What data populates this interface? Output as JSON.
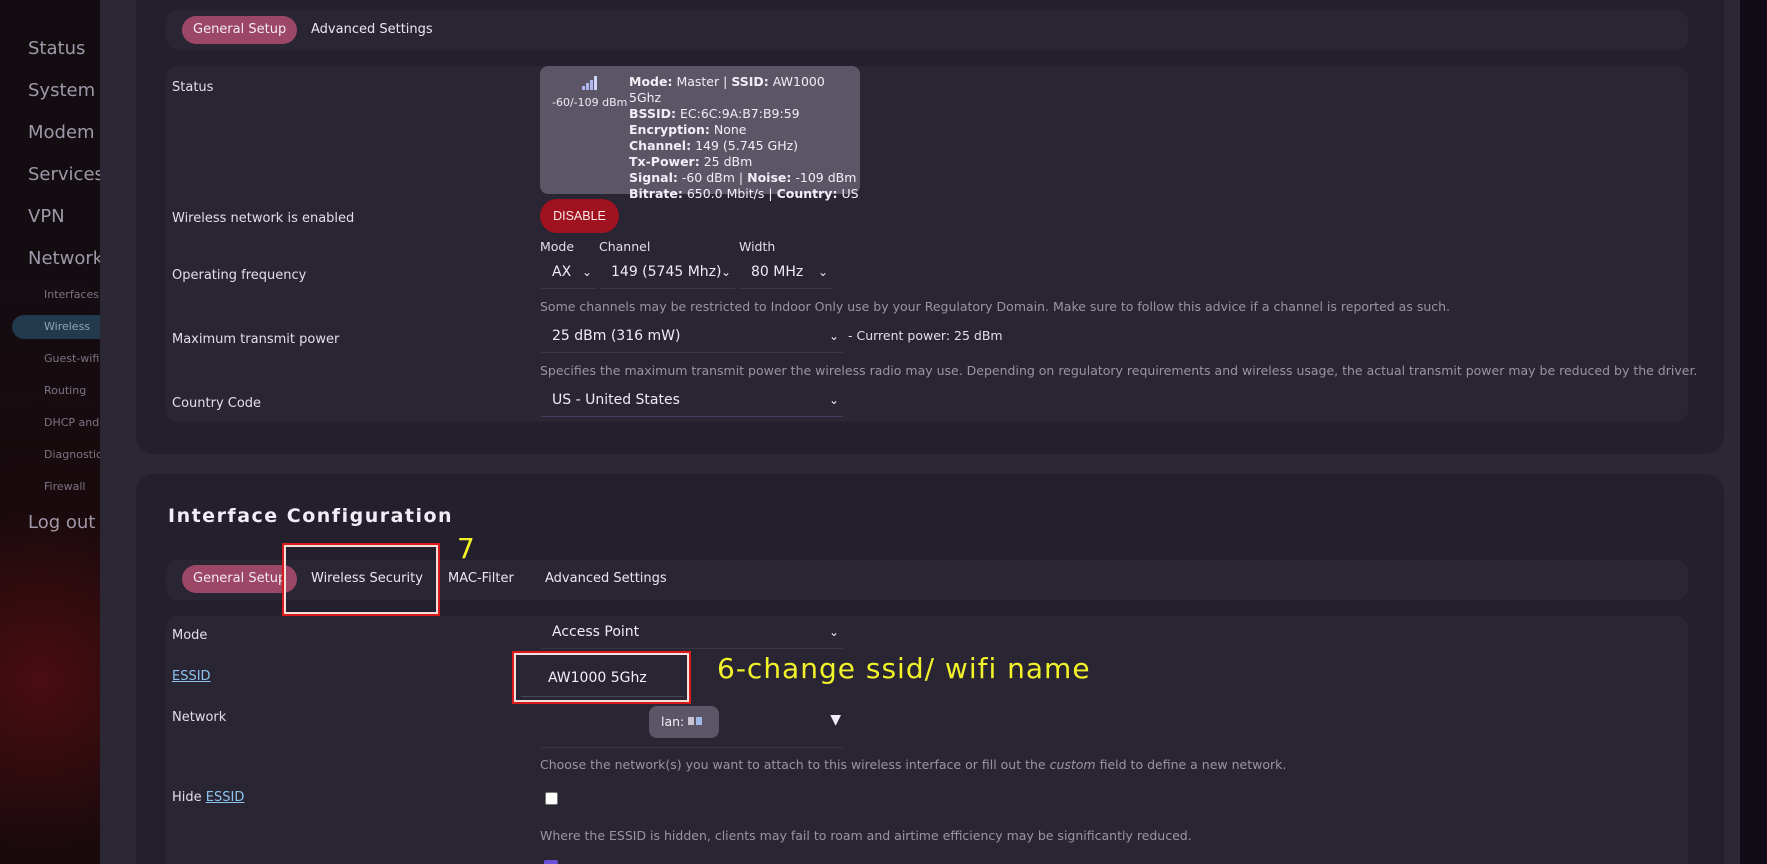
{
  "sidebar": {
    "items": [
      {
        "label": "Status"
      },
      {
        "label": "System"
      },
      {
        "label": "Modem"
      },
      {
        "label": "Services"
      },
      {
        "label": "VPN"
      },
      {
        "label": "Network"
      }
    ],
    "sub_items": [
      {
        "label": "Interfaces"
      },
      {
        "label": "Wireless"
      },
      {
        "label": "Guest-wifi"
      },
      {
        "label": "Routing"
      },
      {
        "label": "DHCP and"
      },
      {
        "label": "Diagnostic"
      },
      {
        "label": "Firewall"
      }
    ],
    "logout": "Log out"
  },
  "device_config": {
    "tabs": [
      {
        "label": "General Setup",
        "active": true
      },
      {
        "label": "Advanced Settings",
        "active": false
      }
    ],
    "status_label": "Status",
    "status": {
      "signal_text": "-60/-109 dBm",
      "mode_key": "Mode:",
      "mode_val": "Master",
      "ssid_key": "SSID:",
      "ssid_val": "AW1000 5Ghz",
      "bssid_key": "BSSID:",
      "bssid_val": "EC:6C:9A:B7:B9:59",
      "enc_key": "Encryption:",
      "enc_val": "None",
      "channel_key": "Channel:",
      "channel_val": "149 (5.745 GHz)",
      "txpower_key": "Tx-Power:",
      "txpower_val": "25 dBm",
      "signal_key": "Signal:",
      "signal_val": "-60 dBm",
      "noise_key": "Noise:",
      "noise_val": "-109 dBm",
      "bitrate_key": "Bitrate:",
      "bitrate_val": "650.0 Mbit/s",
      "country_key": "Country:",
      "country_val": "US",
      "separator": "|"
    },
    "wireless_enabled_label": "Wireless network is enabled",
    "disable_button": "DISABLE",
    "mode_head": "Mode",
    "channel_head": "Channel",
    "width_head": "Width",
    "operating_frequency_label": "Operating frequency",
    "mode_value": "AX",
    "channel_value": "149 (5745 Mhz)",
    "width_value": "80 MHz",
    "channel_hint": "Some channels may be restricted to Indoor Only use by your Regulatory Domain. Make sure to follow this advice if a channel is reported as such.",
    "max_tx_power_label": "Maximum transmit power",
    "tx_power_value": "25 dBm (316 mW)",
    "current_power_text": "- Current power: 25 dBm",
    "tx_power_hint": "Specifies the maximum transmit power the wireless radio may use. Depending on regulatory requirements and wireless usage, the actual transmit power may be reduced by the driver.",
    "country_code_label": "Country Code",
    "country_code_value": "US - United States"
  },
  "interface_config": {
    "title": "Interface Configuration",
    "tabs": [
      {
        "label": "General Setup",
        "active": true
      },
      {
        "label": "Wireless Security",
        "active": false
      },
      {
        "label": "MAC-Filter",
        "active": false
      },
      {
        "label": "Advanced Settings",
        "active": false
      }
    ],
    "mode_label": "Mode",
    "mode_value": "Access Point",
    "essid_label": "ESSID",
    "essid_value": "AW1000 5Ghz",
    "network_label": "Network",
    "network_pill": "lan:",
    "network_hint_pre": "Choose the network(s) you want to attach to this wireless interface or fill out the ",
    "network_hint_em": "custom",
    "network_hint_post": " field to define a new network.",
    "hide_label_pre": "Hide ",
    "hide_label_link": "ESSID",
    "hide_hint": "Where the ESSID is hidden, clients may fail to roam and airtime efficiency may be significantly reduced."
  },
  "annotations": {
    "step7": "7",
    "step6": "6-change ssid/ wifi name",
    "highlight_color": "#d91a1a",
    "annotation_color": "#f2f22a"
  }
}
